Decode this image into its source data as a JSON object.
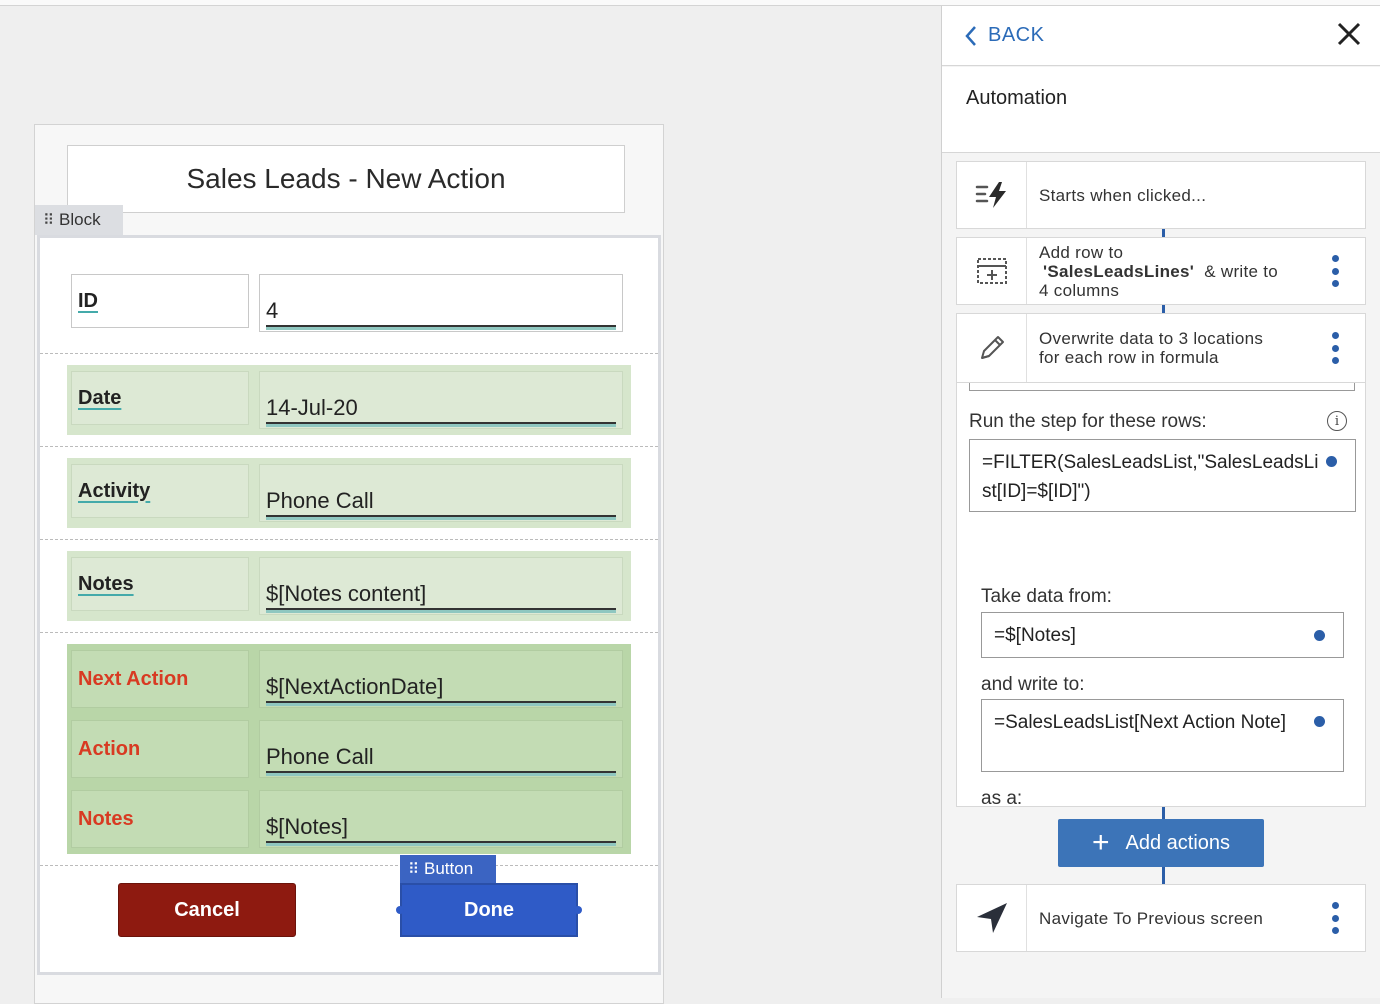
{
  "form": {
    "title": "Sales Leads - New Action",
    "block_tab": "Block",
    "rows": [
      {
        "label": "ID",
        "value": "4"
      },
      {
        "label": "Date",
        "value": "14-Jul-20"
      },
      {
        "label": "Activity",
        "value": "Phone Call"
      },
      {
        "label": "Notes",
        "value": "$[Notes content]"
      }
    ],
    "next_rows": [
      {
        "label": "Next Action",
        "value": "$[NextActionDate]"
      },
      {
        "label": "Action",
        "value": "Phone Call"
      },
      {
        "label": "Notes",
        "value": "$[Notes]"
      }
    ],
    "cancel_label": "Cancel",
    "done_label": "Done",
    "button_tab": "Button"
  },
  "panel": {
    "back_label": "BACK",
    "subtitle": "Automation",
    "trigger_text": "Starts when clicked...",
    "step_add_row": {
      "line1": "Add row to",
      "table": "'SalesLeadsLines'",
      "line2_suffix": "& write to",
      "line3": "4 columns"
    },
    "step_overwrite": {
      "line1": "Overwrite data to 3 locations",
      "line2": "for each row in formula"
    },
    "run_label": "Run the step for these rows:",
    "run_formula": "=FILTER(SalesLeadsList,\"SalesLeadsList[ID]=$[ID]\")",
    "take_label": "Take data from:",
    "take_formula": "=$[Notes]",
    "write_label": "and write to:",
    "write_formula": "=SalesLeadsList[Next Action Note]",
    "as_label": "as a:",
    "add_actions_label": "Add actions",
    "navigate_text": "Navigate To Previous screen"
  },
  "colors": {
    "accent_blue": "#2b6bb8",
    "cancel_red": "#8e1a10",
    "done_blue": "#2f5bc7",
    "label_red": "#d83a22",
    "green_light": "#d6e6cc",
    "green_dark": "#b9d6a8"
  }
}
